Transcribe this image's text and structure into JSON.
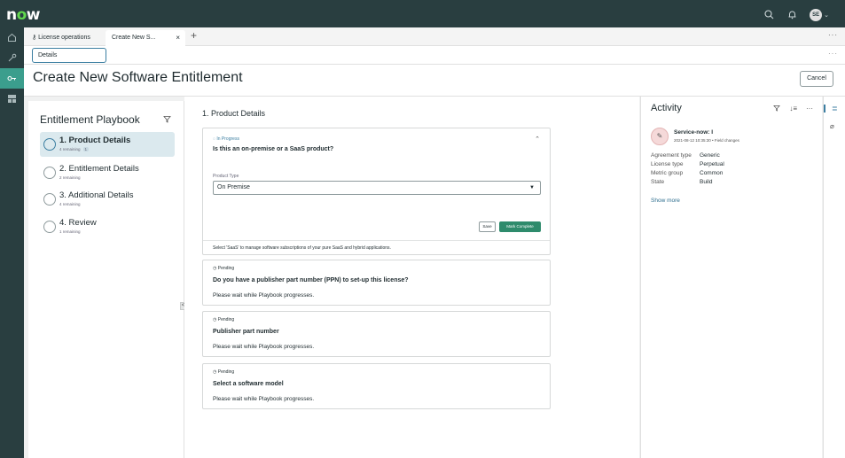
{
  "topbar": {
    "logo_n": "n",
    "logo_o": "o",
    "logo_w": "w",
    "avatar_initials": "SE"
  },
  "tabs": {
    "tab1_label": "License operations",
    "tab2_label": "Create New S...",
    "close_glyph": "×",
    "add_glyph": "+",
    "more_glyph": "···"
  },
  "details": {
    "tab_label": "Details",
    "more_glyph": "···"
  },
  "page": {
    "title": "Create New Software Entitlement",
    "cancel_label": "Cancel"
  },
  "playbook": {
    "title": "Entitlement Playbook",
    "steps": [
      {
        "name": "1. Product Details",
        "sub": "4 remaining",
        "badge": "1"
      },
      {
        "name": "2. Entitlement Details",
        "sub": "2 remaining"
      },
      {
        "name": "3. Additional Details",
        "sub": "4 remaining"
      },
      {
        "name": "4. Review",
        "sub": "1 remaining"
      }
    ],
    "collapse_glyph": "<"
  },
  "main": {
    "section_title": "1. Product Details",
    "card1": {
      "status": "In Progress",
      "question": "Is this an on-premise or a SaaS product?",
      "field_label": "Product Type",
      "field_value": "On Premise",
      "save_label": "Save",
      "complete_label": "Mark Complete",
      "footer": "Select 'SaaS' to manage software subscriptions of your pure SaaS and hybrid applications."
    },
    "pending_cards": [
      {
        "status": "Pending",
        "question": "Do you have a publisher part number (PPN) to set-up this license?",
        "wait": "Please wait while Playbook progresses."
      },
      {
        "status": "Pending",
        "question": "Publisher part number",
        "wait": "Please wait while Playbook progresses."
      },
      {
        "status": "Pending",
        "question": "Select a software model",
        "wait": "Please wait while Playbook progresses."
      }
    ]
  },
  "activity": {
    "title": "Activity",
    "entry_name": "Service-now: I",
    "entry_time": "2021-08-12 10:35:30 • Field changes",
    "rows": [
      {
        "k": "Agreement type",
        "v": "Generic"
      },
      {
        "k": "License type",
        "v": "Perpetual"
      },
      {
        "k": "Metric group",
        "v": "Common"
      },
      {
        "k": "State",
        "v": "Build"
      }
    ],
    "show_more": "Show more"
  },
  "colors": {
    "topbar": "#293e40",
    "accent": "#3b9e8d",
    "primary_button": "#2e8b6c",
    "link": "#2f6f8f"
  }
}
